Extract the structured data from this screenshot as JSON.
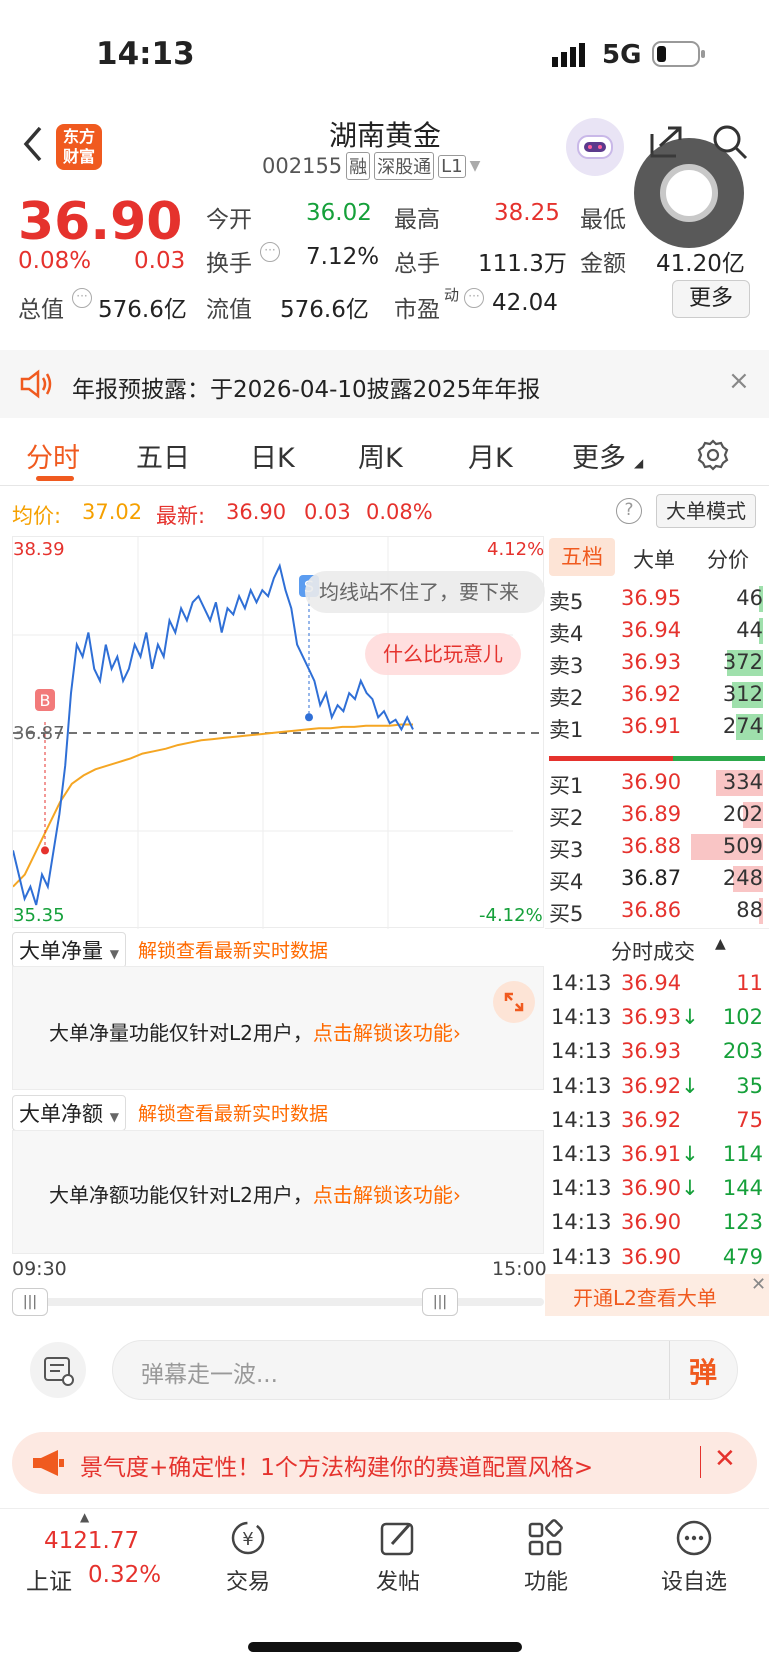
{
  "status": {
    "time": "14:13",
    "network": "5G"
  },
  "header": {
    "back_label": "‹",
    "logo_top": "东方",
    "logo_bottom": "财富",
    "title": "湖南黄金",
    "code": "002155",
    "tags": [
      "融",
      "深股通",
      "L1"
    ]
  },
  "quote": {
    "price": "36.90",
    "change_pct": "0.08%",
    "change": "0.03",
    "open_label": "今开",
    "open": "36.02",
    "high_label": "最高",
    "high": "38.25",
    "low_label": "最低",
    "turnover_label": "换手",
    "turnover": "7.12%",
    "volume_label": "总手",
    "volume": "111.3万",
    "amount_label": "金额",
    "amount": "41.20亿",
    "mcap_label": "总值",
    "mcap": "576.6亿",
    "float_label": "流值",
    "float": "576.6亿",
    "pe_label": "市盈",
    "pe_sup": "动",
    "pe": "42.04",
    "more_label": "更多"
  },
  "notice": {
    "text": "年报预披露：于2026-04-10披露2025年年报",
    "close": "×"
  },
  "tabs": [
    {
      "label": "分时",
      "active": true
    },
    {
      "label": "五日"
    },
    {
      "label": "日K"
    },
    {
      "label": "周K"
    },
    {
      "label": "月K"
    },
    {
      "label": "更多"
    }
  ],
  "subhead": {
    "avg_label": "均价:",
    "avg": "37.02",
    "latest_label": "最新:",
    "latest": "36.90",
    "chg": "0.03",
    "pct": "0.08%",
    "mode_label": "大单模式",
    "help": "?"
  },
  "chart_data": {
    "type": "line",
    "ymax": "38.39",
    "ymin": "35.35",
    "ref": "36.87",
    "pct_up": "4.12%",
    "pct_down": "-4.12%",
    "x_start": "09:30",
    "x_end": "15:00",
    "price_series": [
      35.9,
      35.7,
      35.5,
      35.6,
      35.45,
      35.7,
      35.6,
      35.9,
      36.2,
      36.6,
      37.2,
      37.6,
      37.5,
      37.7,
      37.4,
      37.3,
      37.6,
      37.4,
      37.5,
      37.3,
      37.4,
      37.6,
      37.5,
      37.7,
      37.4,
      37.6,
      37.5,
      37.8,
      37.7,
      37.9,
      37.8,
      37.95,
      38.0,
      37.9,
      37.8,
      37.95,
      37.7,
      37.9,
      37.85,
      38.0,
      37.9,
      38.05,
      37.95,
      38.05,
      38.0,
      38.15,
      38.25,
      38.05,
      37.9,
      37.6,
      37.5,
      37.4,
      37.3,
      37.1,
      37.2,
      37.0,
      37.1,
      37.05,
      37.2,
      37.15,
      37.3,
      37.2,
      37.15,
      37.0,
      37.05,
      36.95,
      36.98,
      36.9,
      37.0,
      36.9
    ],
    "avg_series": [
      35.6,
      35.7,
      35.9,
      36.1,
      36.3,
      36.45,
      36.52,
      36.57,
      36.6,
      36.63,
      36.66,
      36.7,
      36.72,
      36.74,
      36.77,
      36.79,
      36.81,
      36.82,
      36.83,
      36.84,
      36.85,
      36.86,
      36.87,
      36.88,
      36.89,
      36.9,
      36.91,
      36.91,
      36.92,
      36.92,
      36.93,
      36.93,
      36.93,
      36.94,
      36.94
    ],
    "bubbles": [
      "均线站不住了，要下来",
      "什么比玩意儿"
    ],
    "markers": [
      "B",
      "S"
    ]
  },
  "lock": {
    "dd1_label": "大单净量",
    "dd2_label": "大单净额",
    "unlock_link": "解锁查看最新实时数据",
    "msg1": "大单净量功能仅针对L2用户，",
    "msg2": "大单净额功能仅针对L2用户，",
    "action": "点击解锁该功能›"
  },
  "orderbook": {
    "tabs": [
      "五档",
      "大单",
      "分价"
    ],
    "asks": [
      {
        "l": "卖5",
        "p": "36.95",
        "v": "46",
        "w": 0.02
      },
      {
        "l": "卖4",
        "p": "36.94",
        "v": "44",
        "w": 0.02
      },
      {
        "l": "卖3",
        "p": "36.93",
        "v": "372",
        "w": 0.52
      },
      {
        "l": "卖2",
        "p": "36.92",
        "v": "312",
        "w": 0.44
      },
      {
        "l": "卖1",
        "p": "36.91",
        "v": "274",
        "w": 0.38
      }
    ],
    "bids": [
      {
        "l": "买1",
        "p": "36.90",
        "v": "334",
        "w": 0.47
      },
      {
        "l": "买2",
        "p": "36.89",
        "v": "202",
        "w": 0.2
      },
      {
        "l": "买3",
        "p": "36.88",
        "v": "509",
        "w": 0.72
      },
      {
        "l": "买4",
        "p": "36.87",
        "v": "248",
        "w": 0.3
      },
      {
        "l": "买5",
        "p": "36.86",
        "v": "88",
        "w": 0.04
      }
    ]
  },
  "ticks": {
    "title": "分时成交",
    "rows": [
      {
        "t": "14:13",
        "p": "36.94",
        "a": "",
        "v": "11",
        "c": "red"
      },
      {
        "t": "14:13",
        "p": "36.93",
        "a": "↓",
        "v": "102",
        "c": "green"
      },
      {
        "t": "14:13",
        "p": "36.93",
        "a": "",
        "v": "203",
        "c": "green"
      },
      {
        "t": "14:13",
        "p": "36.92",
        "a": "↓",
        "v": "35",
        "c": "green"
      },
      {
        "t": "14:13",
        "p": "36.92",
        "a": "",
        "v": "75",
        "c": "red"
      },
      {
        "t": "14:13",
        "p": "36.91",
        "a": "↓",
        "v": "114",
        "c": "green"
      },
      {
        "t": "14:13",
        "p": "36.90",
        "a": "↓",
        "v": "144",
        "c": "green"
      },
      {
        "t": "14:13",
        "p": "36.90",
        "a": "",
        "v": "123",
        "c": "green"
      },
      {
        "t": "14:13",
        "p": "36.90",
        "a": "",
        "v": "479",
        "c": "green"
      }
    ],
    "l2_label": "开通L2查看大单"
  },
  "comment": {
    "placeholder": "弹幕走一波...",
    "btn": "弹"
  },
  "ad": {
    "text": "景气度+确定性！1个方法构建你的赛道配置风格>",
    "close": "✕"
  },
  "nav": {
    "index_value": "4121.77",
    "index_name": "上证",
    "index_pct": "0.32%",
    "items": [
      "交易",
      "发帖",
      "功能",
      "设自选"
    ]
  }
}
